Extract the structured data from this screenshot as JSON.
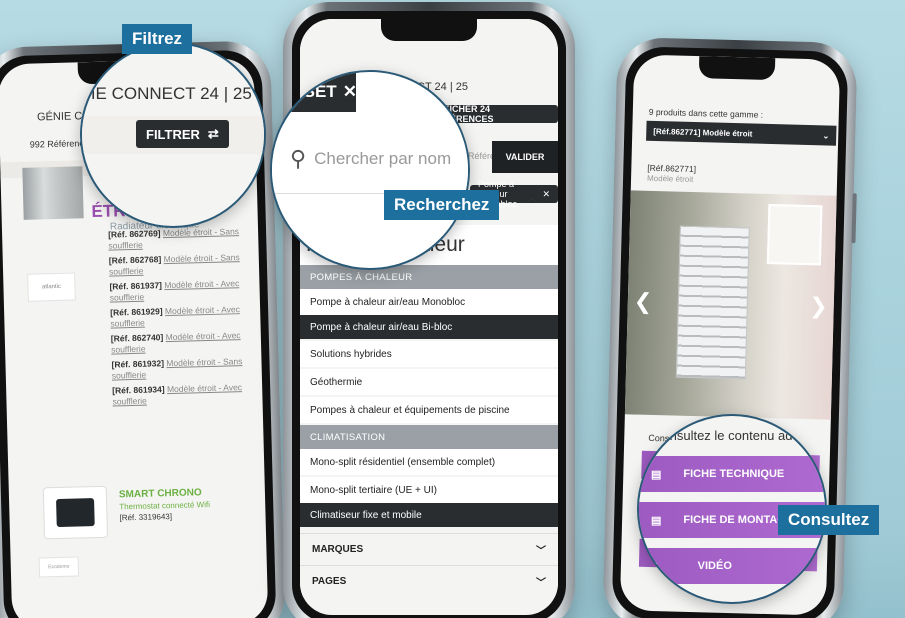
{
  "left_phone": {
    "title": "GÉNIE CONNECT 24 | 25",
    "count": "992 Références",
    "filter_button": "FILTRER",
    "heading": "ÉTROIT",
    "subheading": "Radiateur électrique",
    "references": [
      {
        "ref": "[Réf. 862769]",
        "link": "Modèle étroit - Sans soufflerie"
      },
      {
        "ref": "[Réf. 862768]",
        "link": "Modèle étroit - Sans soufflerie"
      },
      {
        "ref": "[Réf. 861937]",
        "link": "Modèle étroit - Avec soufflerie"
      },
      {
        "ref": "[Réf. 861929]",
        "link": "Modèle étroit - Avec soufflerie"
      },
      {
        "ref": "[Réf. 862740]",
        "link": "Modèle étroit - Avec soufflerie"
      },
      {
        "ref": "[Réf. 861932]",
        "link": "Modèle étroit - Sans soufflerie"
      },
      {
        "ref": "[Réf. 861934]",
        "link": "Modèle étroit - Avec soufflerie"
      }
    ],
    "product2": {
      "name": "SMART CHRONO",
      "desc": "Thermostat connecté Wifi",
      "ref": "[Réf. 3319643]"
    },
    "brand_logo": "atlantic",
    "brand_logo2": "Ecodomo"
  },
  "middle_phone": {
    "title": "GÉNIE CONNECT 24 | 25",
    "reset_button": "RESET",
    "results_button": "AFFICHER 24 RÉFÉRENCES",
    "search_placeholder": "Chercher par nom",
    "reference_placeholder": "Référence",
    "validate_button": "VALIDER",
    "active_chip": "Pompe à chaleur monobloc",
    "search_value": "Pompe à chaleur",
    "sections": [
      {
        "title": "POMPES À CHALEUR",
        "items": [
          "Pompe à chaleur air/eau Monobloc"
        ]
      },
      {
        "selected": "Pompe à chaleur air/eau Bi-bloc"
      }
    ],
    "items_after": [
      "Solutions hybrides",
      "Géothermie",
      "Pompes à chaleur et équipements de piscine"
    ],
    "section_climatisation": "CLIMATISATION",
    "clim_items": [
      "Mono-split résidentiel (ensemble complet)",
      "Mono-split tertiaire (UE + UI)"
    ],
    "clim_selected": "Climatiseur fixe et mobile",
    "accordions": [
      "MARQUES",
      "PAGES"
    ]
  },
  "right_phone": {
    "count": "9 produits dans cette gamme :",
    "selected_model": "[Réf.862771] Modèle étroit",
    "ref": "[Réf.862771]",
    "ref_desc": "Modèle étroit",
    "consult_label": "Consultez le contenu additionnel :",
    "consult_zoom": "Consultez le contenu add",
    "buttons": [
      "FICHE TECHNIQUE",
      "FICHE DE MONTAGE",
      "VIDÉO"
    ]
  },
  "tags": {
    "filter": "Filtrez",
    "search": "Recherchez",
    "consult": "Consultez"
  },
  "colors": {
    "background": "#b7dbe4",
    "accent_purple": "#9d5bc1",
    "tag_blue": "#1d6f9e",
    "dark": "#2a2d30",
    "green": "#6bb042"
  }
}
